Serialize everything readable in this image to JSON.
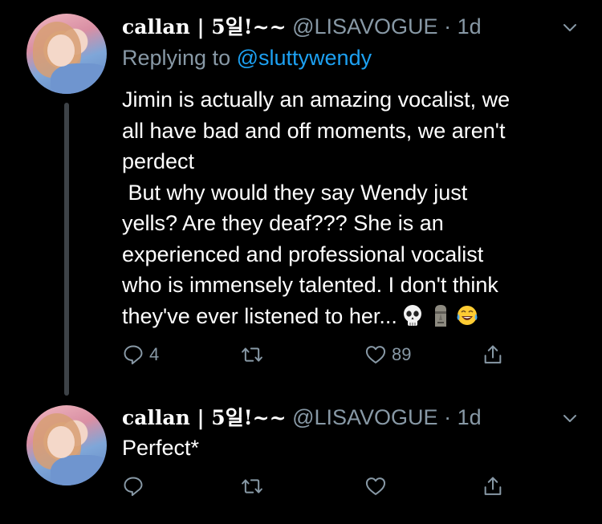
{
  "tweets": [
    {
      "display_name": "callan | 5일!~~",
      "handle": "@LISAVOGUE",
      "separator": "·",
      "time": "1d",
      "replying_label": "Replying to",
      "replying_mention": "@sluttywendy",
      "text": "Jimin is actually an amazing vocalist, we\nall have bad and off moments, we aren't\nperdect\n But why would they say Wendy just\nyells? Are they deaf??? She is an\nexperienced and professional vocalist\nwho is immensely talented. I don't think\nthey've ever listened to her...",
      "emojis": [
        "skull-emoji",
        "moai-emoji",
        "tears-of-joy-emoji"
      ],
      "replies": "4",
      "retweets": "",
      "likes": "89"
    },
    {
      "display_name": "callan | 5일!~~",
      "handle": "@LISAVOGUE",
      "separator": "·",
      "time": "1d",
      "text": "Perfect*",
      "replies": "",
      "retweets": "",
      "likes": ""
    }
  ],
  "colors": {
    "background": "#000000",
    "text": "#ffffff",
    "secondary": "#8899a6",
    "link": "#1da1f2",
    "thread_line": "#3d4247"
  },
  "icons": [
    "reply-icon",
    "retweet-icon",
    "like-icon",
    "share-icon",
    "chevron-down-icon"
  ]
}
